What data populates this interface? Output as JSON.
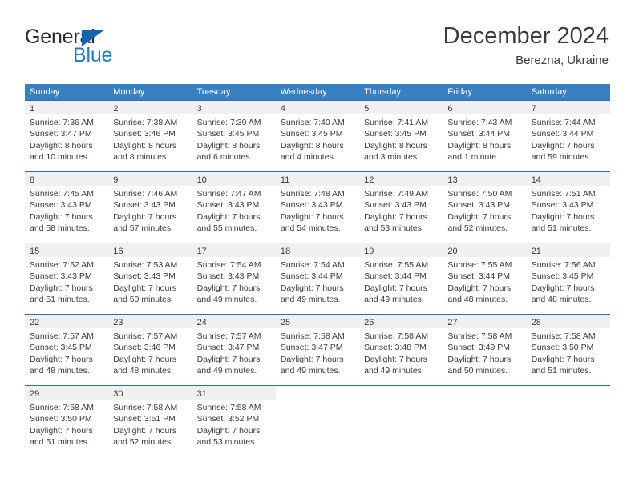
{
  "brand": {
    "word_one": "General",
    "word_two": "Blue",
    "accent_color": "#1f7ac4",
    "triangle_color": "#1565a8"
  },
  "header": {
    "title": "December 2024",
    "subtitle": "Berezna, Ukraine"
  },
  "calendar": {
    "header_bg": "#3880c2",
    "row_divider": "#2f6fad",
    "daynum_bg": "#f0f0f0",
    "weekdays": [
      "Sunday",
      "Monday",
      "Tuesday",
      "Wednesday",
      "Thursday",
      "Friday",
      "Saturday"
    ],
    "weeks": [
      [
        {
          "day": "1",
          "sunrise": "Sunrise: 7:36 AM",
          "sunset": "Sunset: 3:47 PM",
          "daylight_1": "Daylight: 8 hours",
          "daylight_2": "and 10 minutes."
        },
        {
          "day": "2",
          "sunrise": "Sunrise: 7:38 AM",
          "sunset": "Sunset: 3:46 PM",
          "daylight_1": "Daylight: 8 hours",
          "daylight_2": "and 8 minutes."
        },
        {
          "day": "3",
          "sunrise": "Sunrise: 7:39 AM",
          "sunset": "Sunset: 3:45 PM",
          "daylight_1": "Daylight: 8 hours",
          "daylight_2": "and 6 minutes."
        },
        {
          "day": "4",
          "sunrise": "Sunrise: 7:40 AM",
          "sunset": "Sunset: 3:45 PM",
          "daylight_1": "Daylight: 8 hours",
          "daylight_2": "and 4 minutes."
        },
        {
          "day": "5",
          "sunrise": "Sunrise: 7:41 AM",
          "sunset": "Sunset: 3:45 PM",
          "daylight_1": "Daylight: 8 hours",
          "daylight_2": "and 3 minutes."
        },
        {
          "day": "6",
          "sunrise": "Sunrise: 7:43 AM",
          "sunset": "Sunset: 3:44 PM",
          "daylight_1": "Daylight: 8 hours",
          "daylight_2": "and 1 minute."
        },
        {
          "day": "7",
          "sunrise": "Sunrise: 7:44 AM",
          "sunset": "Sunset: 3:44 PM",
          "daylight_1": "Daylight: 7 hours",
          "daylight_2": "and 59 minutes."
        }
      ],
      [
        {
          "day": "8",
          "sunrise": "Sunrise: 7:45 AM",
          "sunset": "Sunset: 3:43 PM",
          "daylight_1": "Daylight: 7 hours",
          "daylight_2": "and 58 minutes."
        },
        {
          "day": "9",
          "sunrise": "Sunrise: 7:46 AM",
          "sunset": "Sunset: 3:43 PM",
          "daylight_1": "Daylight: 7 hours",
          "daylight_2": "and 57 minutes."
        },
        {
          "day": "10",
          "sunrise": "Sunrise: 7:47 AM",
          "sunset": "Sunset: 3:43 PM",
          "daylight_1": "Daylight: 7 hours",
          "daylight_2": "and 55 minutes."
        },
        {
          "day": "11",
          "sunrise": "Sunrise: 7:48 AM",
          "sunset": "Sunset: 3:43 PM",
          "daylight_1": "Daylight: 7 hours",
          "daylight_2": "and 54 minutes."
        },
        {
          "day": "12",
          "sunrise": "Sunrise: 7:49 AM",
          "sunset": "Sunset: 3:43 PM",
          "daylight_1": "Daylight: 7 hours",
          "daylight_2": "and 53 minutes."
        },
        {
          "day": "13",
          "sunrise": "Sunrise: 7:50 AM",
          "sunset": "Sunset: 3:43 PM",
          "daylight_1": "Daylight: 7 hours",
          "daylight_2": "and 52 minutes."
        },
        {
          "day": "14",
          "sunrise": "Sunrise: 7:51 AM",
          "sunset": "Sunset: 3:43 PM",
          "daylight_1": "Daylight: 7 hours",
          "daylight_2": "and 51 minutes."
        }
      ],
      [
        {
          "day": "15",
          "sunrise": "Sunrise: 7:52 AM",
          "sunset": "Sunset: 3:43 PM",
          "daylight_1": "Daylight: 7 hours",
          "daylight_2": "and 51 minutes."
        },
        {
          "day": "16",
          "sunrise": "Sunrise: 7:53 AM",
          "sunset": "Sunset: 3:43 PM",
          "daylight_1": "Daylight: 7 hours",
          "daylight_2": "and 50 minutes."
        },
        {
          "day": "17",
          "sunrise": "Sunrise: 7:54 AM",
          "sunset": "Sunset: 3:43 PM",
          "daylight_1": "Daylight: 7 hours",
          "daylight_2": "and 49 minutes."
        },
        {
          "day": "18",
          "sunrise": "Sunrise: 7:54 AM",
          "sunset": "Sunset: 3:44 PM",
          "daylight_1": "Daylight: 7 hours",
          "daylight_2": "and 49 minutes."
        },
        {
          "day": "19",
          "sunrise": "Sunrise: 7:55 AM",
          "sunset": "Sunset: 3:44 PM",
          "daylight_1": "Daylight: 7 hours",
          "daylight_2": "and 49 minutes."
        },
        {
          "day": "20",
          "sunrise": "Sunrise: 7:55 AM",
          "sunset": "Sunset: 3:44 PM",
          "daylight_1": "Daylight: 7 hours",
          "daylight_2": "and 48 minutes."
        },
        {
          "day": "21",
          "sunrise": "Sunrise: 7:56 AM",
          "sunset": "Sunset: 3:45 PM",
          "daylight_1": "Daylight: 7 hours",
          "daylight_2": "and 48 minutes."
        }
      ],
      [
        {
          "day": "22",
          "sunrise": "Sunrise: 7:57 AM",
          "sunset": "Sunset: 3:45 PM",
          "daylight_1": "Daylight: 7 hours",
          "daylight_2": "and 48 minutes."
        },
        {
          "day": "23",
          "sunrise": "Sunrise: 7:57 AM",
          "sunset": "Sunset: 3:46 PM",
          "daylight_1": "Daylight: 7 hours",
          "daylight_2": "and 48 minutes."
        },
        {
          "day": "24",
          "sunrise": "Sunrise: 7:57 AM",
          "sunset": "Sunset: 3:47 PM",
          "daylight_1": "Daylight: 7 hours",
          "daylight_2": "and 49 minutes."
        },
        {
          "day": "25",
          "sunrise": "Sunrise: 7:58 AM",
          "sunset": "Sunset: 3:47 PM",
          "daylight_1": "Daylight: 7 hours",
          "daylight_2": "and 49 minutes."
        },
        {
          "day": "26",
          "sunrise": "Sunrise: 7:58 AM",
          "sunset": "Sunset: 3:48 PM",
          "daylight_1": "Daylight: 7 hours",
          "daylight_2": "and 49 minutes."
        },
        {
          "day": "27",
          "sunrise": "Sunrise: 7:58 AM",
          "sunset": "Sunset: 3:49 PM",
          "daylight_1": "Daylight: 7 hours",
          "daylight_2": "and 50 minutes."
        },
        {
          "day": "28",
          "sunrise": "Sunrise: 7:58 AM",
          "sunset": "Sunset: 3:50 PM",
          "daylight_1": "Daylight: 7 hours",
          "daylight_2": "and 51 minutes."
        }
      ],
      [
        {
          "day": "29",
          "sunrise": "Sunrise: 7:58 AM",
          "sunset": "Sunset: 3:50 PM",
          "daylight_1": "Daylight: 7 hours",
          "daylight_2": "and 51 minutes."
        },
        {
          "day": "30",
          "sunrise": "Sunrise: 7:58 AM",
          "sunset": "Sunset: 3:51 PM",
          "daylight_1": "Daylight: 7 hours",
          "daylight_2": "and 52 minutes."
        },
        {
          "day": "31",
          "sunrise": "Sunrise: 7:58 AM",
          "sunset": "Sunset: 3:52 PM",
          "daylight_1": "Daylight: 7 hours",
          "daylight_2": "and 53 minutes."
        },
        {
          "day": "",
          "sunrise": "",
          "sunset": "",
          "daylight_1": "",
          "daylight_2": ""
        },
        {
          "day": "",
          "sunrise": "",
          "sunset": "",
          "daylight_1": "",
          "daylight_2": ""
        },
        {
          "day": "",
          "sunrise": "",
          "sunset": "",
          "daylight_1": "",
          "daylight_2": ""
        },
        {
          "day": "",
          "sunrise": "",
          "sunset": "",
          "daylight_1": "",
          "daylight_2": ""
        }
      ]
    ]
  }
}
